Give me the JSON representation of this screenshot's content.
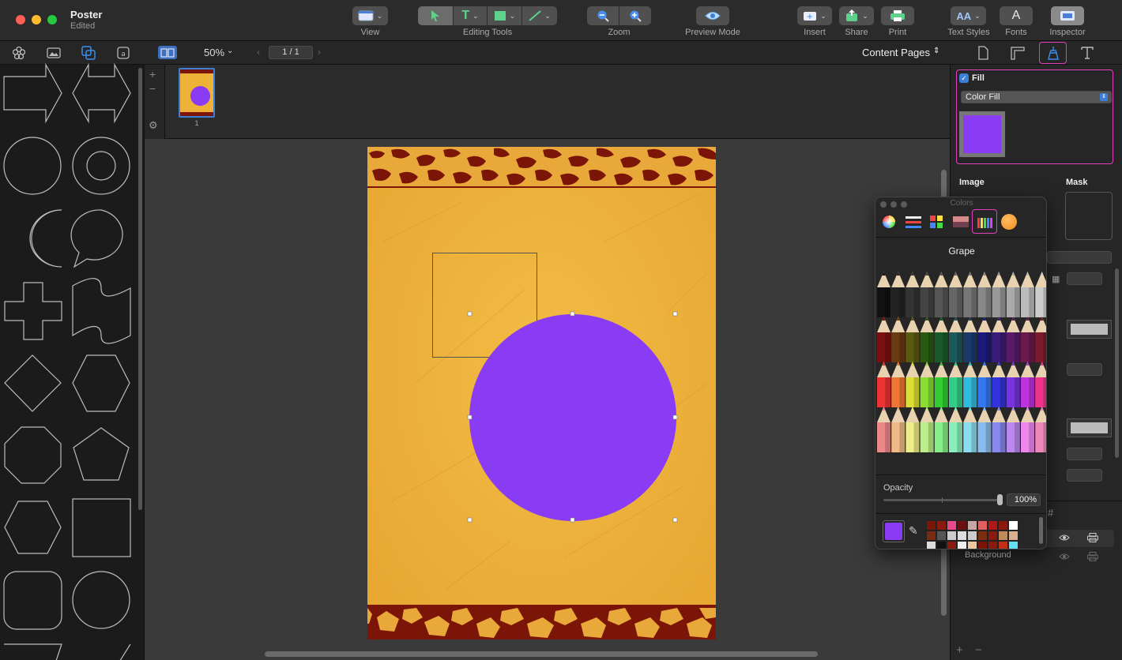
{
  "window": {
    "title": "Poster",
    "subtitle": "Edited"
  },
  "toolbar": {
    "view": "View",
    "editing_tools": "Editing Tools",
    "zoom": "Zoom",
    "preview_mode": "Preview Mode",
    "insert": "Insert",
    "share": "Share",
    "print": "Print",
    "text_styles": "Text Styles",
    "fonts": "Fonts",
    "inspector": "Inspector"
  },
  "canvas_bar": {
    "zoom_level": "50%",
    "page_indicator": "1 / 1",
    "content_pages": "Content Pages"
  },
  "thumbnails": [
    {
      "page_number": "1"
    }
  ],
  "inspector": {
    "fill_label": "Fill",
    "fill_checked": true,
    "fill_type": "Color Fill",
    "fill_color": "#8a3cf5",
    "image_label": "Image",
    "mask_label": "Mask",
    "background_label": "Background"
  },
  "colors_panel": {
    "title": "Colors",
    "selected_color_name": "Grape",
    "opacity_label": "Opacity",
    "opacity_value": "100%",
    "opacity": 1.0,
    "current_color": "#8a3cf5"
  },
  "document": {
    "background_color": "#eeb238",
    "circle_color": "#8a3cf5",
    "border_color": "#7a1508"
  }
}
